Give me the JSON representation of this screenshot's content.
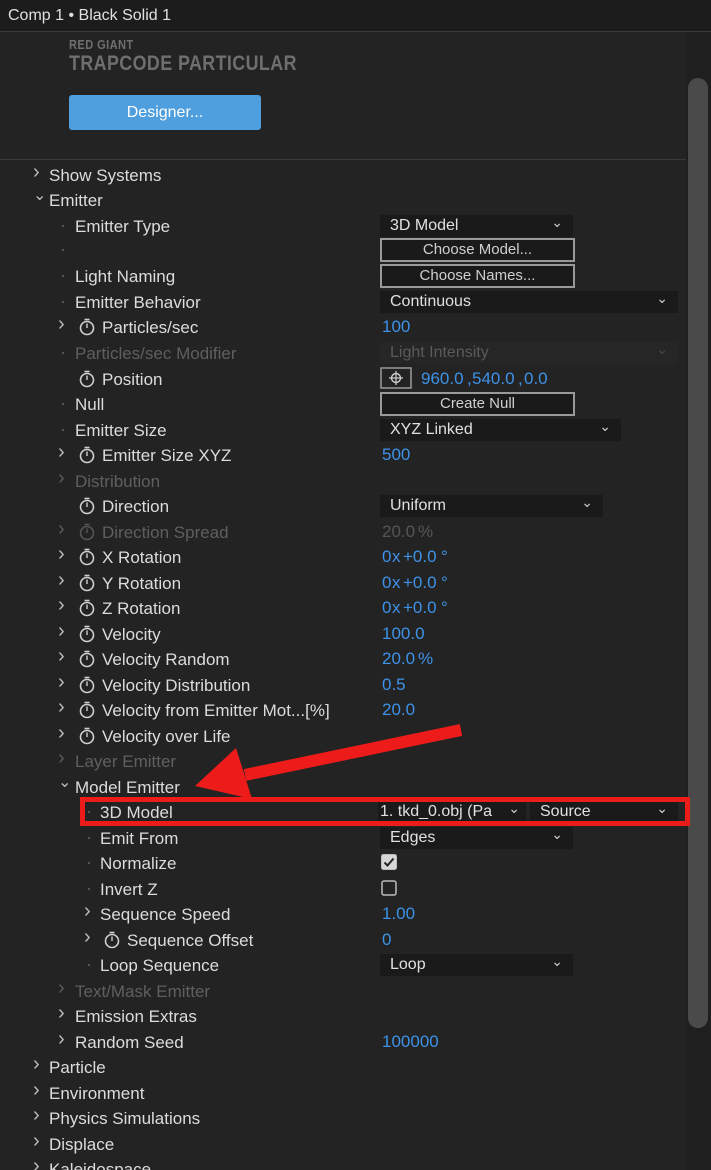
{
  "window": {
    "title": "Comp 1 • Black Solid 1"
  },
  "logo": {
    "line1": "RED GIANT",
    "line2": "TRAPCODE PARTICULAR"
  },
  "designer_button": "Designer...",
  "rows": {
    "show_systems": "Show Systems",
    "emitter": "Emitter",
    "emitter_type": {
      "label": "Emitter Type",
      "value": "3D Model"
    },
    "choose_model": "Choose Model...",
    "light_naming": {
      "label": "Light Naming",
      "button": "Choose Names..."
    },
    "emitter_behavior": {
      "label": "Emitter Behavior",
      "value": "Continuous"
    },
    "particles_sec": {
      "label": "Particles/sec",
      "value": "100"
    },
    "particles_sec_modifier": {
      "label": "Particles/sec Modifier",
      "value": "Light Intensity"
    },
    "position": {
      "label": "Position",
      "x": "960.0",
      "y": "540.0",
      "z": "0.0",
      "sep": ","
    },
    "null": {
      "label": "Null",
      "button": "Create Null"
    },
    "emitter_size": {
      "label": "Emitter Size",
      "value": "XYZ Linked"
    },
    "emitter_size_xyz": {
      "label": "Emitter Size XYZ",
      "value": "500"
    },
    "distribution": "Distribution",
    "direction": {
      "label": "Direction",
      "value": "Uniform"
    },
    "direction_spread": {
      "label": "Direction Spread",
      "value": "20.0",
      "unit": "%"
    },
    "x_rotation": {
      "label": "X Rotation",
      "turns": "0",
      "x": "x",
      "deg": "+0.0",
      "unit": "°"
    },
    "y_rotation": {
      "label": "Y Rotation",
      "turns": "0",
      "x": "x",
      "deg": "+0.0",
      "unit": "°"
    },
    "z_rotation": {
      "label": "Z Rotation",
      "turns": "0",
      "x": "x",
      "deg": "+0.0",
      "unit": "°"
    },
    "velocity": {
      "label": "Velocity",
      "value": "100.0"
    },
    "velocity_random": {
      "label": "Velocity Random",
      "value": "20.0",
      "unit": "%"
    },
    "velocity_distribution": {
      "label": "Velocity Distribution",
      "value": "0.5"
    },
    "velocity_from_emitter": {
      "label": "Velocity from Emitter Mot...[%]",
      "value": "20.0"
    },
    "velocity_over_life": "Velocity over Life",
    "layer_emitter": "Layer Emitter",
    "model_emitter": "Model Emitter",
    "model_3d": {
      "label": "3D Model",
      "value": "1. tkd_0.obj (Pa",
      "source": "Source"
    },
    "emit_from": {
      "label": "Emit From",
      "value": "Edges"
    },
    "normalize": {
      "label": "Normalize",
      "checked": true
    },
    "invert_z": {
      "label": "Invert Z",
      "checked": false
    },
    "sequence_speed": {
      "label": "Sequence Speed",
      "value": "1.00"
    },
    "sequence_offset": {
      "label": "Sequence Offset",
      "value": "0"
    },
    "loop_sequence": {
      "label": "Loop Sequence",
      "value": "Loop"
    },
    "text_mask_emitter": "Text/Mask Emitter",
    "emission_extras": "Emission Extras",
    "random_seed": {
      "label": "Random Seed",
      "value": "100000"
    },
    "particle": "Particle",
    "environment": "Environment",
    "physics_simulations": "Physics Simulations",
    "displace": "Displace",
    "kaleidospace": "Kaleidospace"
  },
  "annotation": {
    "arrow_color": "#ee1b1b",
    "box_color": "#ee1b1b"
  }
}
